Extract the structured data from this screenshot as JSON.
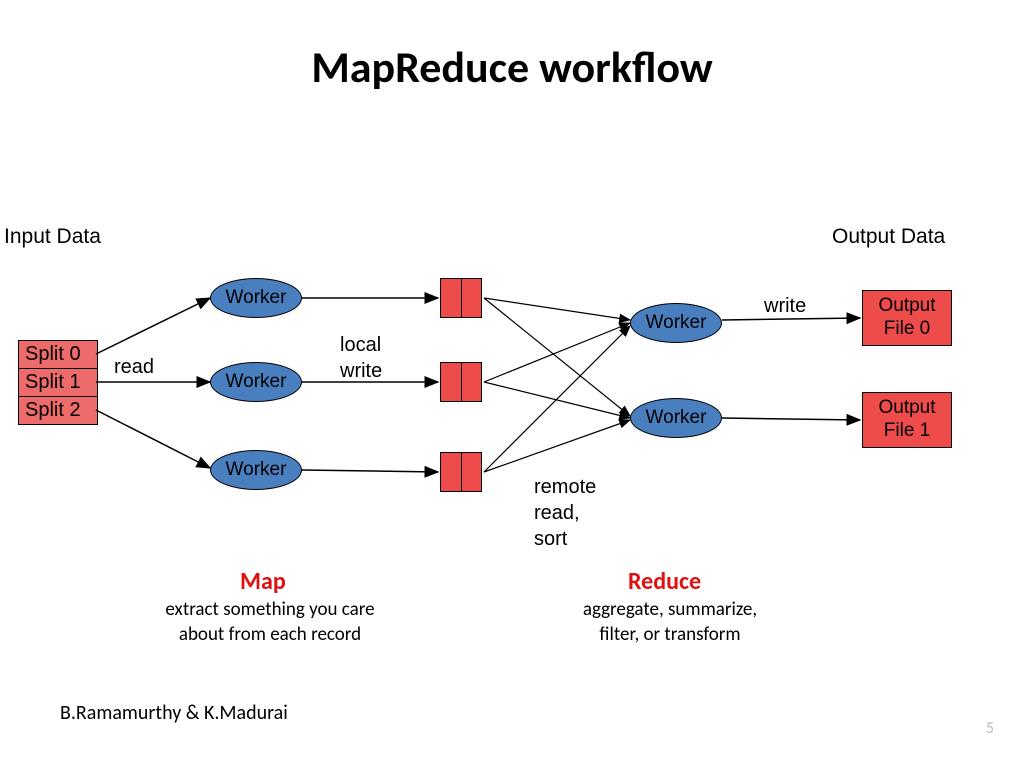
{
  "title": "MapReduce workflow",
  "labels": {
    "input_data": "Input Data",
    "output_data": "Output Data"
  },
  "splits": [
    "Split 0",
    "Split 1",
    "Split 2"
  ],
  "workers": {
    "map": [
      "Worker",
      "Worker",
      "Worker"
    ],
    "reduce": [
      "Worker",
      "Worker"
    ]
  },
  "output_files": [
    "Output File 0",
    "Output File 1"
  ],
  "edge_labels": {
    "read": "read",
    "local_write_1": "local",
    "local_write_2": "write",
    "remote_read_1": "remote",
    "remote_read_2": "read,",
    "remote_read_3": "sort",
    "write": "write"
  },
  "phases": {
    "map": {
      "title": "Map",
      "desc": "extract something you care about from each record"
    },
    "reduce": {
      "title": "Reduce",
      "desc": "aggregate, summarize, filter, or transform"
    }
  },
  "authors": "B.Ramamurthy & K.Madurai",
  "page_number": "5"
}
